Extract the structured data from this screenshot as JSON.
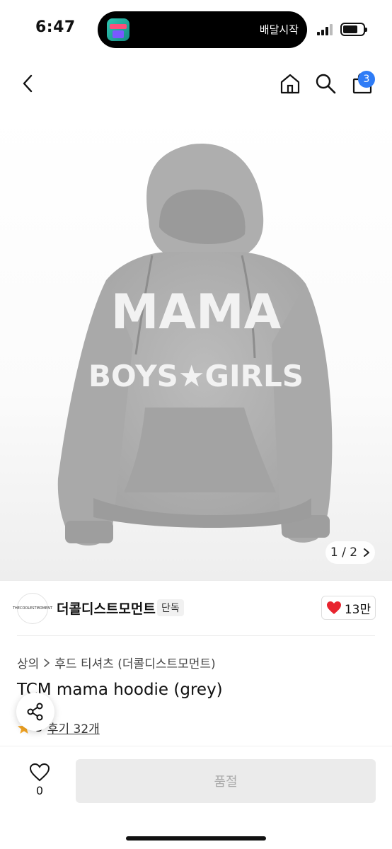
{
  "status_bar": {
    "time": "6:47",
    "live_activity_text": "배달시작",
    "live_activity_app_icon": "delivery-app-icon",
    "signal_icon": "cellular-signal-icon",
    "battery_icon": "battery-icon"
  },
  "nav": {
    "back_icon": "chevron-left-icon",
    "home_icon": "home-icon",
    "search_icon": "search-icon",
    "cart_icon": "shopping-bag-icon",
    "cart_count": "3",
    "badge_color": "#2f7cf6"
  },
  "gallery": {
    "image_subject": "grey hoodie",
    "print_line1": "MAMA",
    "print_line2": "BOYS★GIRLS",
    "counter": "1 / 2",
    "next_icon": "chevron-right-icon"
  },
  "seller": {
    "logo_text": "THECOOLESTMOMENT",
    "name": "더콜디스트모먼트",
    "badge": "단독",
    "likes": "13만",
    "heart_color": "#e8242f"
  },
  "product": {
    "breadcrumb": [
      "상의",
      "후드 티셔츠 (더콜디스트모먼트)"
    ],
    "title": "TCM mama hoodie (grey)",
    "rating": "5",
    "reviews": "후기 32개"
  },
  "share": {
    "icon": "share-icon"
  },
  "bottom_bar": {
    "like_count": "0",
    "cta_label": "품절"
  }
}
